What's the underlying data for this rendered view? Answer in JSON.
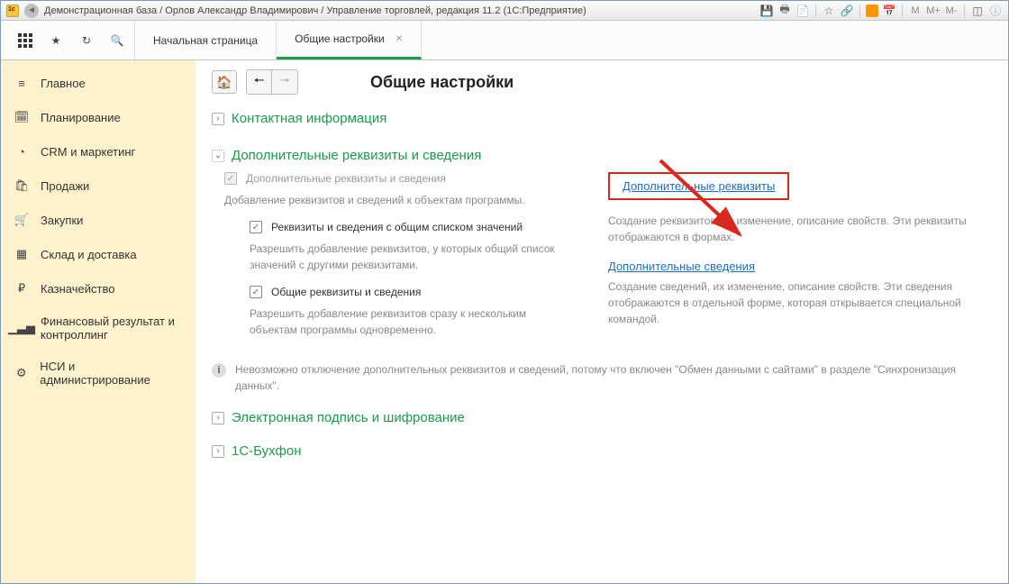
{
  "titlebar": {
    "text": "Демонстрационная база / Орлов Александр Владимирович / Управление торговлей, редакция 11.2  (1С:Предприятие)"
  },
  "tabs": [
    {
      "label": "Начальная страница",
      "active": false
    },
    {
      "label": "Общие настройки",
      "active": true
    }
  ],
  "sidebar": {
    "items": [
      {
        "icon": "menu",
        "label": "Главное"
      },
      {
        "icon": "calendar",
        "label": "Планирование"
      },
      {
        "icon": "pie",
        "label": "CRM и маркетинг"
      },
      {
        "icon": "bag",
        "label": "Продажи"
      },
      {
        "icon": "cart",
        "label": "Закупки"
      },
      {
        "icon": "boxes",
        "label": "Склад и доставка"
      },
      {
        "icon": "ruble",
        "label": "Казначейство"
      },
      {
        "icon": "chart",
        "label": "Финансовый результат и контроллинг"
      },
      {
        "icon": "gear",
        "label": "НСИ и администрирование"
      }
    ]
  },
  "content": {
    "title": "Общие настройки",
    "sections": {
      "contact": {
        "title": "Контактная информация",
        "expanded": false
      },
      "additional": {
        "title": "Дополнительные реквизиты и сведения",
        "expanded": true,
        "chk_main_label": "Дополнительные реквизиты и сведения",
        "desc_main": "Добавление реквизитов и сведений к объектам программы.",
        "chk_common_label": "Реквизиты и сведения с общим списком значений",
        "desc_common": "Разрешить добавление реквизитов, у которых общий список значений с другими реквизитами.",
        "chk_shared_label": "Общие реквизиты и сведения",
        "desc_shared": "Разрешить добавление реквизитов сразу к нескольким объектам программы одновременно.",
        "link1": "Дополнительные реквизиты",
        "link1_desc": "Создание реквизитов, их изменение, описание свойств. Эти реквизиты отображаются в формах.",
        "link2": "Дополнительные сведения",
        "link2_desc": "Создание сведений, их изменение, описание свойств. Эти сведения отображаются в отдельной форме, которая открывается специальной командой.",
        "info_text": "Невозможно отключение дополнительных реквизитов и сведений, потому что включен \"Обмен данными с сайтами\" в разделе \"Синхронизация данных\"."
      },
      "signature": {
        "title": "Электронная подпись и шифрование",
        "expanded": false
      },
      "buhphone": {
        "title": "1С-Бухфон",
        "expanded": false
      }
    }
  }
}
